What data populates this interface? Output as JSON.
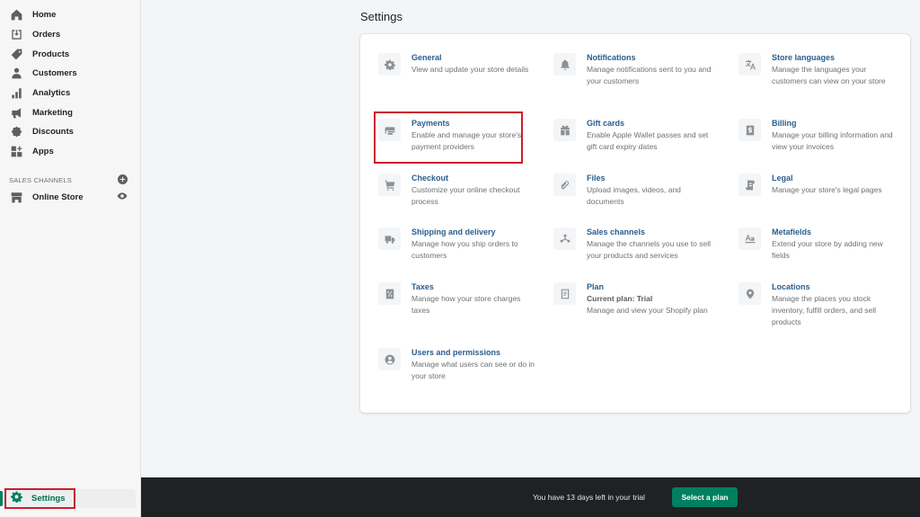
{
  "sidebar": {
    "items": [
      {
        "label": "Home",
        "icon": "home-icon"
      },
      {
        "label": "Orders",
        "icon": "orders-icon"
      },
      {
        "label": "Products",
        "icon": "tag-icon"
      },
      {
        "label": "Customers",
        "icon": "person-icon"
      },
      {
        "label": "Analytics",
        "icon": "bar-chart-icon"
      },
      {
        "label": "Marketing",
        "icon": "megaphone-icon"
      },
      {
        "label": "Discounts",
        "icon": "discount-icon"
      },
      {
        "label": "Apps",
        "icon": "apps-icon"
      }
    ],
    "sales_channels": {
      "heading": "SALES CHANNELS",
      "add_icon": "plus-circle-icon",
      "items": [
        {
          "label": "Online Store",
          "icon": "store-icon",
          "action_icon": "eye-icon"
        }
      ]
    },
    "settings": {
      "label": "Settings",
      "icon": "gear-icon",
      "active": true
    }
  },
  "main": {
    "title": "Settings",
    "settings": [
      {
        "title": "General",
        "description": "View and update your store details",
        "icon": "gear-icon"
      },
      {
        "title": "Notifications",
        "description": "Manage notifications sent to you and your customers",
        "icon": "bell-icon"
      },
      {
        "title": "Store languages",
        "description": "Manage the languages your customers can view on your store",
        "icon": "translate-icon"
      },
      {
        "title": "Payments",
        "description": "Enable and manage your store's payment providers",
        "icon": "credit-card-icon",
        "highlighted": true
      },
      {
        "title": "Gift cards",
        "description": "Enable Apple Wallet passes and set gift card expiry dates",
        "icon": "gift-icon"
      },
      {
        "title": "Billing",
        "description": "Manage your billing information and view your invoices",
        "icon": "dollar-bill-icon"
      },
      {
        "title": "Checkout",
        "description": "Customize your online checkout process",
        "icon": "cart-icon"
      },
      {
        "title": "Files",
        "description": "Upload images, videos, and documents",
        "icon": "paperclip-icon"
      },
      {
        "title": "Legal",
        "description": "Manage your store's legal pages",
        "icon": "document-icon"
      },
      {
        "title": "Shipping and delivery",
        "description": "Manage how you ship orders to customers",
        "icon": "truck-icon"
      },
      {
        "title": "Sales channels",
        "description": "Manage the channels you use to sell your products and services",
        "icon": "channels-icon"
      },
      {
        "title": "Metafields",
        "description": "Extend your store by adding new fields",
        "icon": "metafields-icon"
      },
      {
        "title": "Taxes",
        "description": "Manage how your store charges taxes",
        "icon": "tax-icon"
      },
      {
        "title": "Plan",
        "subtitle": "Current plan: Trial",
        "description": "Manage and view your Shopify plan",
        "icon": "plan-icon"
      },
      {
        "title": "Locations",
        "description": "Manage the places you stock inventory, fulfill orders, and sell products",
        "icon": "location-pin-icon"
      },
      {
        "title": "Users and permissions",
        "description": "Manage what users can see or do in your store",
        "icon": "user-circle-icon"
      }
    ]
  },
  "trial_bar": {
    "message": "You have 13 days left in your trial",
    "button_label": "Select a plan"
  },
  "colors": {
    "accent": "#008060",
    "highlight_border": "#c8202f",
    "link": "#2a5d8f",
    "trial_bar_bg": "#202123"
  }
}
